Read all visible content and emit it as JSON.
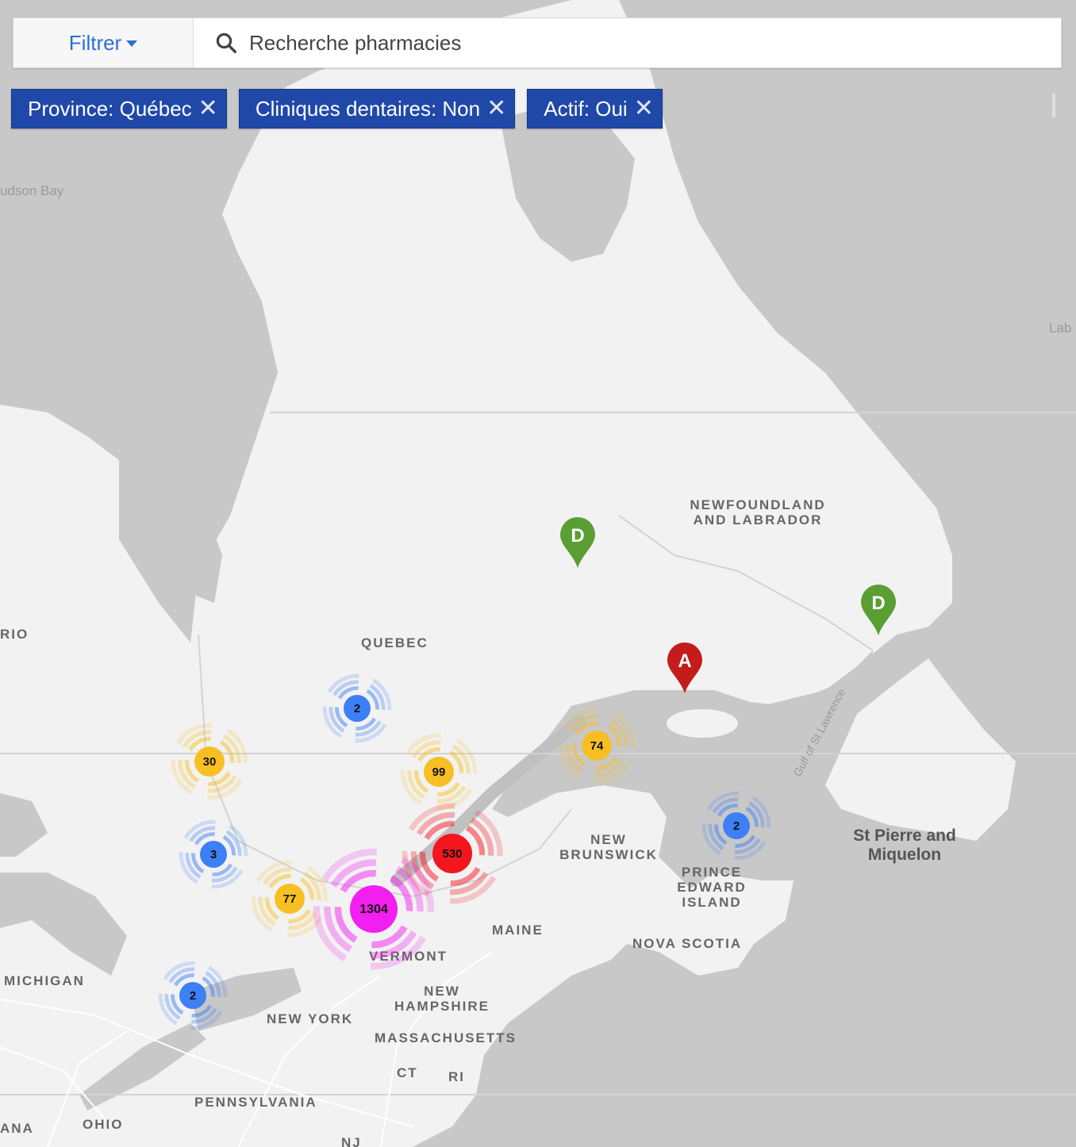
{
  "toolbar": {
    "filter_label": "Filtrer",
    "search_placeholder": "Recherche pharmacies"
  },
  "filters": [
    {
      "label": "Province: Québec",
      "remove": "✕"
    },
    {
      "label": "Cliniques dentaires: Non",
      "remove": "✕"
    },
    {
      "label": "Actif: Oui",
      "remove": "✕"
    }
  ],
  "map": {
    "labels": {
      "hudson_bay": "udson Bay",
      "lab": "Lab",
      "newfoundland": "NEWFOUNDLAND\nAND LABRADOR",
      "ontario": "RIO",
      "quebec": "QUEBEC",
      "new_brunswick": "NEW\nBRUNSWICK",
      "pei": "PRINCE\nEDWARD\nISLAND",
      "nova_scotia": "NOVA SCOTIA",
      "maine": "MAINE",
      "vermont": "VERMONT",
      "new_hampshire": "NEW\nHAMPSHIRE",
      "massachusetts": "MASSACHUSETTS",
      "ct": "CT",
      "ri": "RI",
      "new_york": "NEW YORK",
      "michigan": "MICHIGAN",
      "pennsylvania": "PENNSYLVANIA",
      "ohio": "OHIO",
      "indiana": "ANA",
      "nj": "NJ",
      "st_pierre": "St Pierre and\nMiquelon",
      "gulf": "Gulf of St Lawrence"
    },
    "clusters": [
      {
        "count": "2",
        "color": "#3d7ff5"
      },
      {
        "count": "30",
        "color": "#f7bf24"
      },
      {
        "count": "99",
        "color": "#f7bf24"
      },
      {
        "count": "74",
        "color": "#f7bf24"
      },
      {
        "count": "2",
        "color": "#3d7ff5"
      },
      {
        "count": "3",
        "color": "#3d7ff5"
      },
      {
        "count": "530",
        "color": "#f3161f"
      },
      {
        "count": "77",
        "color": "#f7bf24"
      },
      {
        "count": "1304",
        "color": "#f21ff0"
      },
      {
        "count": "2",
        "color": "#3d7ff5"
      }
    ],
    "markers": [
      {
        "letter": "D",
        "color": "#5a9e34"
      },
      {
        "letter": "D",
        "color": "#5a9e34"
      },
      {
        "letter": "A",
        "color": "#c41c1c"
      }
    ]
  }
}
